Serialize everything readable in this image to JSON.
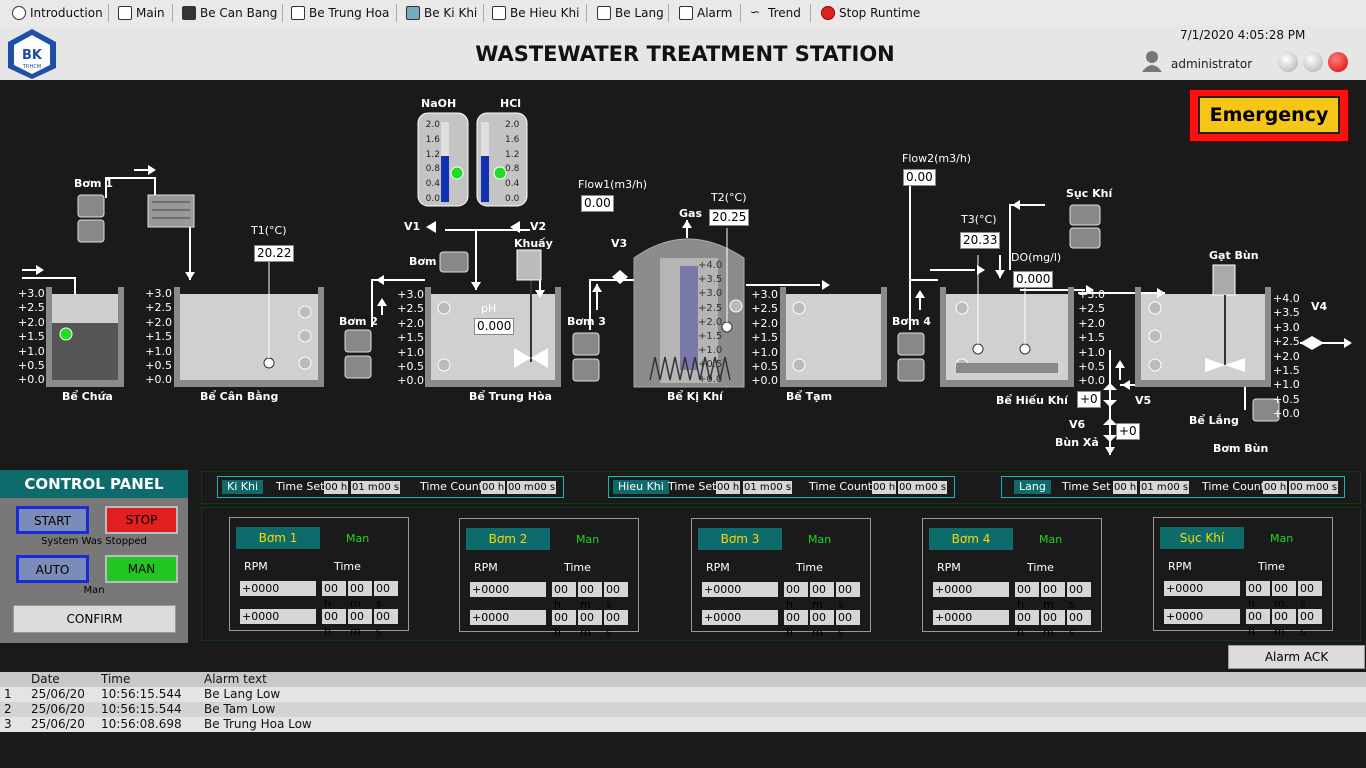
{
  "nav": {
    "items": [
      "Introduction",
      "Main",
      "Be Can Bang",
      "Be Trung Hoa",
      "Be Ki Khi",
      "Be Hieu Khi",
      "Be Lang",
      "Alarm",
      "Trend",
      "Stop Runtime"
    ]
  },
  "header": {
    "title": "WASTEWATER TREATMENT STATION",
    "datetime": "7/1/2020 4:05:28 PM",
    "user": "administrator",
    "logo_text": "BK",
    "logo_sub": "TP.HCM"
  },
  "emergency": {
    "label": "Emergency"
  },
  "scene": {
    "tanks": {
      "be_chua": "Bể Chứa",
      "be_can_bang": "Bể Cân Bằng",
      "be_trung_hoa": "Bể Trung Hòa",
      "be_ki_khi": "Bể Kị Khí",
      "be_tam": "Bể Tạm",
      "be_hieu_khi": "Bể Hiếu Khí",
      "be_lang": "Bể Lắng"
    },
    "pumps": {
      "bom1": "Bơm 1",
      "bom2": "Bơm 2",
      "bom3": "Bơm 3",
      "bom4": "Bơm 4",
      "bom": "Bơm",
      "bom_bun": "Bơm Bùn",
      "sut_khi": "Sục Khí",
      "gat_bun": "Gạt Bùn",
      "khuay": "Khuấy",
      "bun_xa": "Bùn Xả"
    },
    "chem": {
      "naoh": "NaOH",
      "hcl": "HCl"
    },
    "valves": {
      "v1": "V1",
      "v2": "V2",
      "v3": "V3",
      "v4": "V4",
      "v5": "V5",
      "v6": "V6"
    },
    "gas": "Gas",
    "sensors": {
      "t1_label": "T1(°C)",
      "t1": "20.22",
      "ph_label": "pH",
      "ph": "0.000",
      "flow1_label": "Flow1(m3/h)",
      "flow1": "0.00",
      "t2_label": "T2(°C)",
      "t2": "20.25",
      "flow2_label": "Flow2(m3/h)",
      "flow2": "0.00",
      "t3_label": "T3(°C)",
      "t3": "20.33",
      "do_label": "DO(mg/l)",
      "do": "0.000",
      "v5_value": "+0",
      "v6_value": "+0"
    },
    "scale3": [
      "+3.0",
      "+2.5",
      "+2.0",
      "+1.5",
      "+1.0",
      "+0.5",
      "+0.0"
    ],
    "scale4": [
      "+4.0",
      "+3.5",
      "+3.0",
      "+2.5",
      "+2.0",
      "+1.5",
      "+1.0",
      "+0.5",
      "+0.0"
    ],
    "scale_chem": [
      "2.0",
      "1.6",
      "1.2",
      "0.8",
      "0.4",
      "0.0"
    ]
  },
  "control_panel": {
    "title": "CONTROL PANEL",
    "start": "START",
    "stop": "STOP",
    "status": "System Was Stopped",
    "auto": "AUTO",
    "man": "MAN",
    "mode": "Man",
    "confirm": "CONFIRM"
  },
  "timers": [
    {
      "name": "Ki Khi",
      "set_label": "Time Set",
      "set": [
        "00 h",
        "01 m",
        "00 s"
      ],
      "count_label": "Time Count",
      "count": [
        "00 h",
        "00 m",
        "00 s"
      ]
    },
    {
      "name": "Hieu Khi",
      "set_label": "Time Set",
      "set": [
        "00 h",
        "01 m",
        "00 s"
      ],
      "count_label": "Time Count",
      "count": [
        "00 h",
        "00 m",
        "00 s"
      ]
    },
    {
      "name": "Lang",
      "set_label": "Time Set",
      "set": [
        "00 h",
        "01 m",
        "00 s"
      ],
      "count_label": "Time Count",
      "count": [
        "00 h",
        "00 m",
        "00 s"
      ]
    }
  ],
  "pump_panels": [
    {
      "name": "Bơm 1",
      "mode": "Man",
      "rpm_label": "RPM",
      "time_label": "Time",
      "rpm": [
        "+0000",
        "+0000"
      ],
      "time": [
        [
          "00 h",
          "00 m",
          "00 s"
        ],
        [
          "00 h",
          "00 m",
          "00 s"
        ]
      ]
    },
    {
      "name": "Bơm 2",
      "mode": "Man",
      "rpm_label": "RPM",
      "time_label": "Time",
      "rpm": [
        "+0000",
        "+0000"
      ],
      "time": [
        [
          "00 h",
          "00 m",
          "00 s"
        ],
        [
          "00 h",
          "00 m",
          "00 s"
        ]
      ]
    },
    {
      "name": "Bơm 3",
      "mode": "Man",
      "rpm_label": "RPM",
      "time_label": "Time",
      "rpm": [
        "+0000",
        "+0000"
      ],
      "time": [
        [
          "00 h",
          "00 m",
          "00 s"
        ],
        [
          "00 h",
          "00 m",
          "00 s"
        ]
      ]
    },
    {
      "name": "Bơm 4",
      "mode": "Man",
      "rpm_label": "RPM",
      "time_label": "Time",
      "rpm": [
        "+0000",
        "+0000"
      ],
      "time": [
        [
          "00 h",
          "00 m",
          "00 s"
        ],
        [
          "00 h",
          "00 m",
          "00 s"
        ]
      ]
    },
    {
      "name": "Sục Khí",
      "mode": "Man",
      "rpm_label": "RPM",
      "time_label": "Time",
      "rpm": [
        "+0000",
        "+0000"
      ],
      "time": [
        [
          "00 h",
          "00 m",
          "00 s"
        ],
        [
          "00 h",
          "00 m",
          "00 s"
        ]
      ]
    }
  ],
  "alarm": {
    "ack": "Alarm ACK",
    "columns": [
      "",
      "Date",
      "Time",
      "Alarm text"
    ],
    "rows": [
      [
        "1",
        "25/06/20",
        "10:56:15.544",
        "Be Lang Low"
      ],
      [
        "2",
        "25/06/20",
        "10:56:15.544",
        "Be Tam Low"
      ],
      [
        "3",
        "25/06/20",
        "10:56:08.698",
        "Be Trung Hoa Low"
      ]
    ]
  },
  "colors": {
    "teal": "#0e6b6b",
    "emergency": "#f5c518",
    "stop": "#e02020",
    "man": "#22c622"
  }
}
